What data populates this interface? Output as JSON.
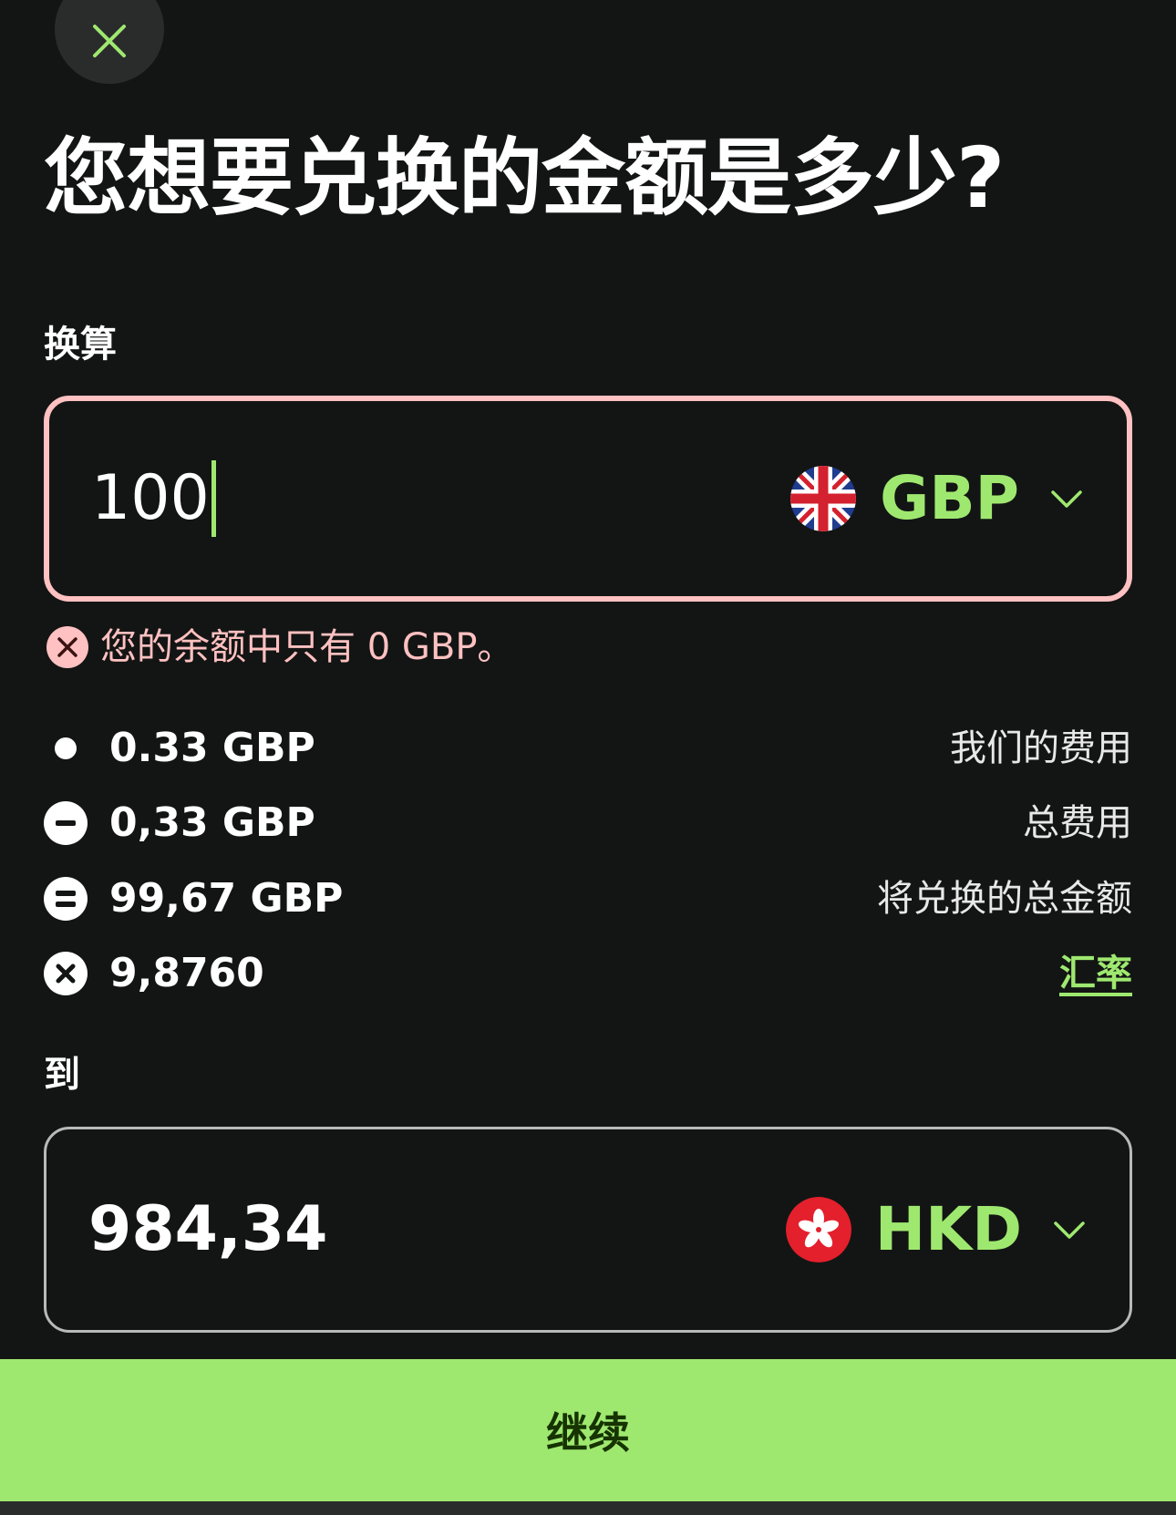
{
  "header": {
    "title": "您想要兑换的金额是多少?"
  },
  "from": {
    "label": "换算",
    "amount": "100",
    "currency": "GBP",
    "flag_icon": "uk-flag-icon",
    "error": "您的余额中只有 0 GBP。"
  },
  "fees": [
    {
      "icon": "dot-icon",
      "amount": "0.33 GBP",
      "description": "我们的费用"
    },
    {
      "icon": "minus-circle-icon",
      "amount": "0,33 GBP",
      "description": "总费用"
    },
    {
      "icon": "equals-circle-icon",
      "amount": "99,67 GBP",
      "description": "将兑换的总金额"
    },
    {
      "icon": "times-circle-icon",
      "amount": "9,8760",
      "description": "汇率"
    }
  ],
  "to": {
    "label": "到",
    "amount": "984,34",
    "currency": "HKD",
    "flag_icon": "hk-flag-icon"
  },
  "actions": {
    "continue_label": "继续"
  },
  "colors": {
    "background": "#131514",
    "accent": "#9fe870",
    "error": "#ffc1c1",
    "button_text": "#163300"
  }
}
